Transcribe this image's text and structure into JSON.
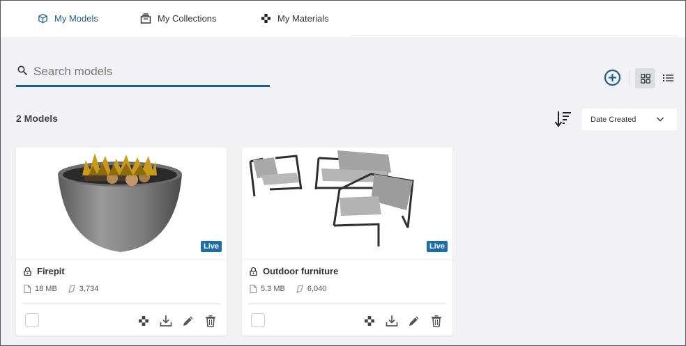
{
  "tabs": [
    {
      "label": "My Models",
      "icon": "cube-icon",
      "active": true
    },
    {
      "label": "My Collections",
      "icon": "collection-icon",
      "active": false
    },
    {
      "label": "My Materials",
      "icon": "material-icon",
      "active": false
    }
  ],
  "search": {
    "placeholder": "Search models",
    "value": ""
  },
  "toolbar": {
    "add_icon": "add-circle-icon",
    "grid_icon": "grid-view-icon",
    "list_icon": "list-view-icon"
  },
  "models_count_label": "2 Models",
  "sort": {
    "selected": "Date Created",
    "icon": "sort-descending-icon"
  },
  "cards": [
    {
      "title": "Firepit",
      "size": "18 MB",
      "polygons": "3,734",
      "badge": "Live"
    },
    {
      "title": "Outdoor furniture",
      "size": "5.3 MB",
      "polygons": "6,040",
      "badge": "Live"
    }
  ],
  "colors": {
    "accent": "#1c5f8e",
    "live_badge": "#1c6ea4",
    "background": "#f2f2f5"
  }
}
